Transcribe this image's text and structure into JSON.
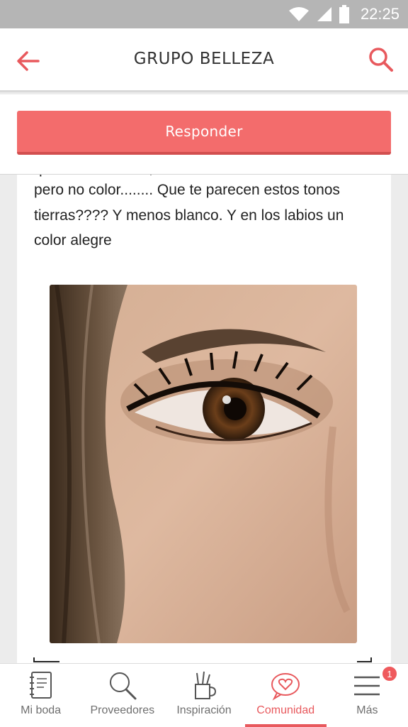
{
  "status_bar": {
    "time": "22:25"
  },
  "header": {
    "title": "GRUPO BELLEZA",
    "back_icon": "arrow-left-icon",
    "search_icon": "search-icon"
  },
  "reply": {
    "label": "Responder"
  },
  "post": {
    "cutoff_text": "quedan naturales, le has dado más intensidad",
    "text": "pero no color........ Que te parecen estos tonos tierras???? Y menos blanco. Y en los labios un color alegre"
  },
  "nav": {
    "items": [
      {
        "label": "Mi boda",
        "icon": "notebook-icon"
      },
      {
        "label": "Proveedores",
        "icon": "search-icon"
      },
      {
        "label": "Inspiración",
        "icon": "pencil-cup-icon"
      },
      {
        "label": "Comunidad",
        "icon": "heart-chat-icon",
        "active": true
      },
      {
        "label": "Más",
        "icon": "menu-icon",
        "badge": "1"
      }
    ]
  },
  "colors": {
    "accent": "#f36c6c",
    "active": "#e8595d",
    "status_bar": "#b5b5b5"
  }
}
